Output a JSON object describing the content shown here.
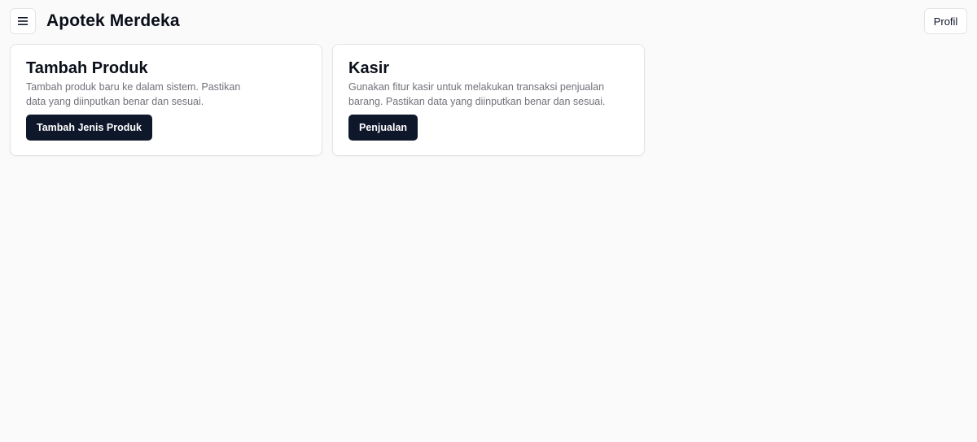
{
  "header": {
    "menu_icon": "hamburger-menu-icon",
    "title": "Apotek Merdeka",
    "profile_label": "Profil"
  },
  "cards": [
    {
      "title": "Tambah Produk",
      "description_lines": [
        "Tambah produk baru ke dalam sistem. Pastikan",
        "data yang diinputkan benar dan sesuai."
      ],
      "button_label": "Tambah Jenis Produk"
    },
    {
      "title": "Kasir",
      "description_lines": [
        "Gunakan fitur kasir untuk melakukan transaksi penjualan",
        "barang. Pastikan data yang diinputkan benar dan sesuai."
      ],
      "button_label": "Penjualan"
    }
  ],
  "colors": {
    "background": "#fafafa",
    "card_border": "#e4e4e7",
    "primary_button": "#0f172a",
    "muted_text": "#71717a"
  }
}
